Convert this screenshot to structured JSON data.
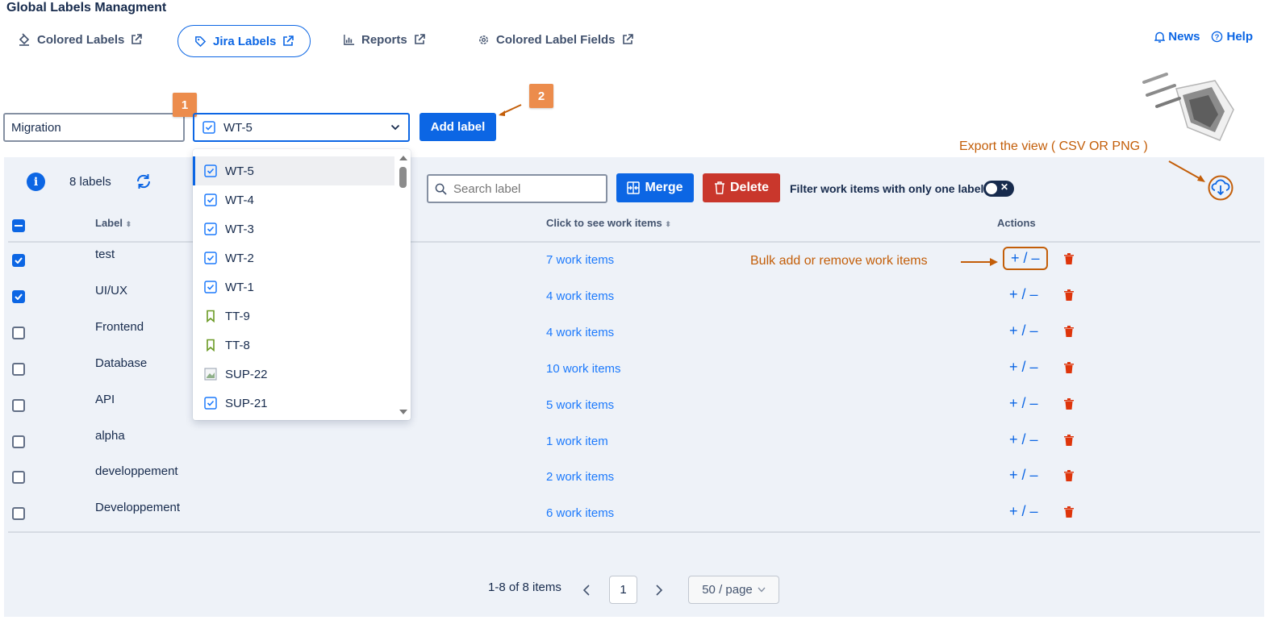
{
  "app": {
    "title": "Global Labels Managment"
  },
  "tabs": [
    {
      "label": "Colored Labels",
      "icon": "paint-bucket-icon",
      "active": false
    },
    {
      "label": "Jira Labels",
      "icon": "tag-icon",
      "active": true
    },
    {
      "label": "Reports",
      "icon": "bar-chart-icon",
      "active": false
    },
    {
      "label": "Colored Label Fields",
      "icon": "gear-icon",
      "active": false
    }
  ],
  "header_links": {
    "news": "News",
    "help": "Help"
  },
  "form": {
    "label_value": "Migration",
    "selected_item": "WT-5",
    "add_button": "Add label"
  },
  "annotations": {
    "step1": "1",
    "step2": "2",
    "export_note": "Export the view ( CSV OR PNG )",
    "bulk_note": "Bulk add or remove work items"
  },
  "dropdown": {
    "options": [
      {
        "key": "WT-5",
        "type": "task",
        "selected": true
      },
      {
        "key": "WT-4",
        "type": "task"
      },
      {
        "key": "WT-3",
        "type": "task"
      },
      {
        "key": "WT-2",
        "type": "task"
      },
      {
        "key": "WT-1",
        "type": "task"
      },
      {
        "key": "TT-9",
        "type": "story"
      },
      {
        "key": "TT-8",
        "type": "story"
      },
      {
        "key": "SUP-22",
        "type": "image"
      },
      {
        "key": "SUP-21",
        "type": "task"
      }
    ]
  },
  "toolbar": {
    "count": "8 labels",
    "search_placeholder": "Search label",
    "merge": "Merge",
    "delete": "Delete",
    "filter_label": "Filter work items with only one label"
  },
  "table": {
    "headers": {
      "label": "Label",
      "work_items": "Click to see work items",
      "actions": "Actions"
    },
    "rows": [
      {
        "label": "test",
        "items": "7 work items",
        "checked": true
      },
      {
        "label": "UI/UX",
        "items": "4 work items",
        "checked": true
      },
      {
        "label": "Frontend",
        "items": "4 work items",
        "checked": false
      },
      {
        "label": "Database",
        "items": "10 work items",
        "checked": false
      },
      {
        "label": "API",
        "items": "5 work items",
        "checked": false
      },
      {
        "label": "alpha",
        "items": "1 work item",
        "checked": false
      },
      {
        "label": "developpement",
        "items": "2 work items",
        "checked": false
      },
      {
        "label": "Developpement",
        "items": "6 work items",
        "checked": false
      }
    ],
    "action_text": "+ / –"
  },
  "pagination": {
    "info": "1-8 of 8 items",
    "page": "1",
    "page_size": "50 / page"
  },
  "colors": {
    "primary": "#0c66e4",
    "danger": "#c9372c",
    "annotation": "#c35e09",
    "step_badge": "#ec8c4c"
  }
}
